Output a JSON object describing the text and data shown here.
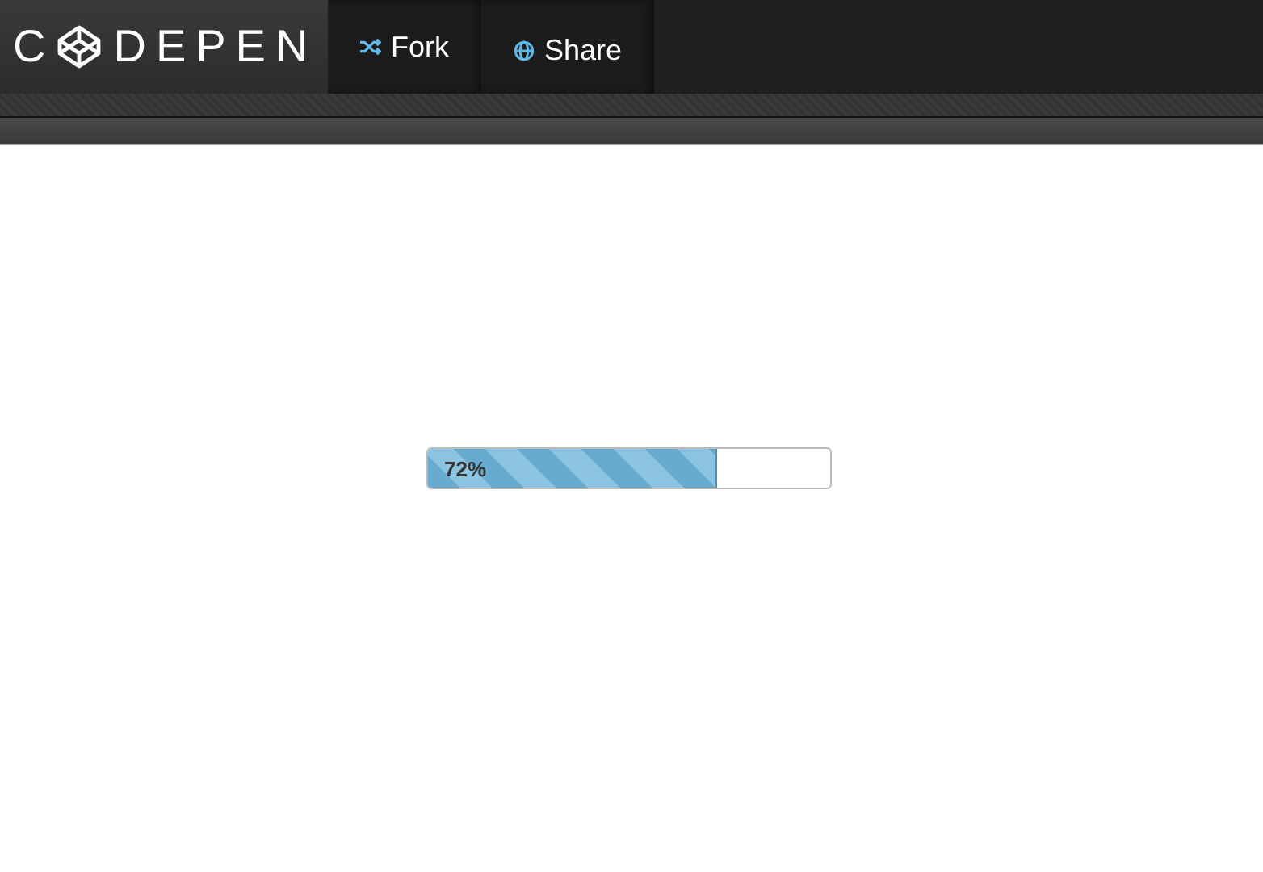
{
  "logo": {
    "before": "C",
    "after": "DEPEN"
  },
  "buttons": [
    {
      "kind": "fork",
      "label": "Fork"
    },
    {
      "kind": "share",
      "label": "Share"
    }
  ],
  "progress": {
    "level": 0.72,
    "label": "72%"
  }
}
